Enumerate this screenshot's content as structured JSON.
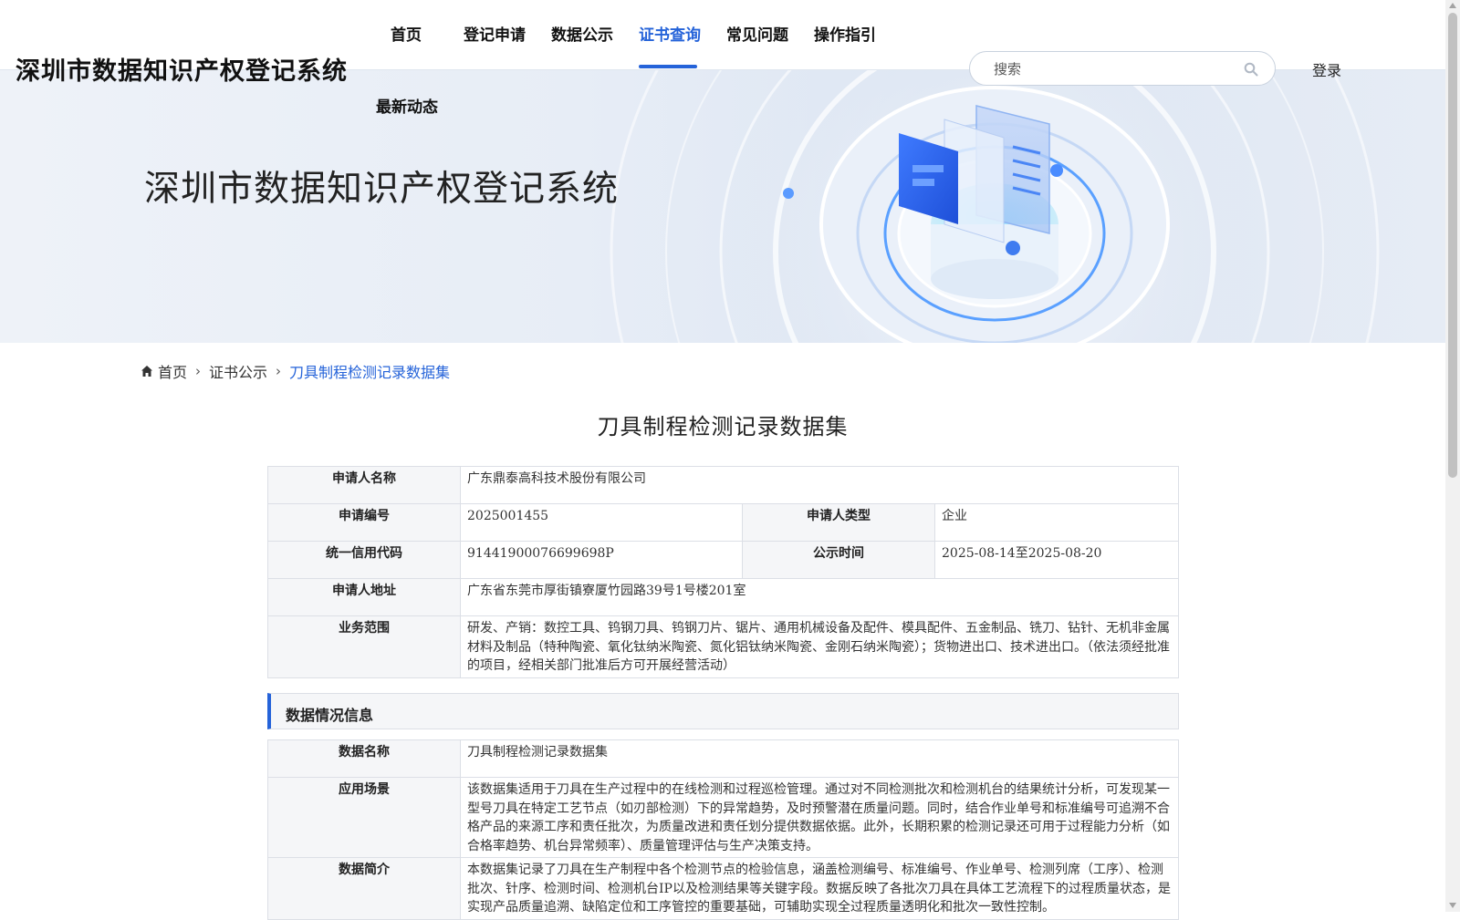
{
  "header": {
    "site_title": "深圳市数据知识产权登记系统",
    "nav": [
      {
        "label": "首页",
        "active": false
      },
      {
        "label": "登记申请",
        "active": false
      },
      {
        "label": "数据公示",
        "active": false
      },
      {
        "label": "证书查询",
        "active": true
      },
      {
        "label": "常见问题",
        "active": false
      },
      {
        "label": "操作指引",
        "active": false
      },
      {
        "label": "最新动态",
        "active": false
      }
    ],
    "search_placeholder": "搜索",
    "search_icon": "search-icon",
    "login_label": "登录",
    "accent_color": "#2563d9"
  },
  "banner": {
    "title": "深圳市数据知识产权登记系统"
  },
  "breadcrumb": {
    "home_icon": "home-icon",
    "items": [
      "首页",
      "证书公示",
      "刀具制程检测记录数据集"
    ]
  },
  "page_title": "刀具制程检测记录数据集",
  "applicant": {
    "name_label": "申请人名称",
    "name_value": "广东鼎泰高科技术股份有限公司",
    "app_no_label": "申请编号",
    "app_no_value": "2025001455",
    "type_label": "申请人类型",
    "type_value": "企业",
    "credit_label": "统一信用代码",
    "credit_value": "91441900076699698P",
    "notice_label": "公示时间",
    "notice_value": "2025-08-14至2025-08-20",
    "address_label": "申请人地址",
    "address_value": "广东省东莞市厚街镇寮厦竹园路39号1号楼201室",
    "scope_label": "业务范围",
    "scope_value": "研发、产销：数控工具、钨钢刀具、钨钢刀片、锯片、通用机械设备及配件、模具配件、五金制品、铣刀、钻针、无机非金属材料及制品（特种陶瓷、氧化钛纳米陶瓷、氮化铝钛纳米陶瓷、金刚石纳米陶瓷）；货物进出口、技术进出口。（依法须经批准的项目，经相关部门批准后方可开展经营活动）"
  },
  "data_section": {
    "header": "数据情况信息",
    "name_label": "数据名称",
    "name_value": "刀具制程检测记录数据集",
    "scene_label": "应用场景",
    "scene_value": "该数据集适用于刀具在生产过程中的在线检测和过程巡检管理。通过对不同检测批次和检测机台的结果统计分析，可发现某一型号刀具在特定工艺节点（如刃部检测）下的异常趋势，及时预警潜在质量问题。同时，结合作业单号和标准编号可追溯不合格产品的来源工序和责任批次，为质量改进和责任划分提供数据依据。此外，长期积累的检测记录还可用于过程能力分析（如合格率趋势、机台异常频率）、质量管理评估与生产决策支持。",
    "intro_label": "数据简介",
    "intro_value": "本数据集记录了刀具在生产制程中各个检测节点的检验信息，涵盖检测编号、标准编号、作业单号、检测列席（工序）、检测批次、针序、检测时间、检测机台IP以及检测结果等关键字段。数据反映了各批次刀具在具体工艺流程下的过程质量状态，是实现产品质量追溯、缺陷定位和工序管控的重要基础，可辅助实现全过程质量透明化和批次一致性控制。"
  }
}
